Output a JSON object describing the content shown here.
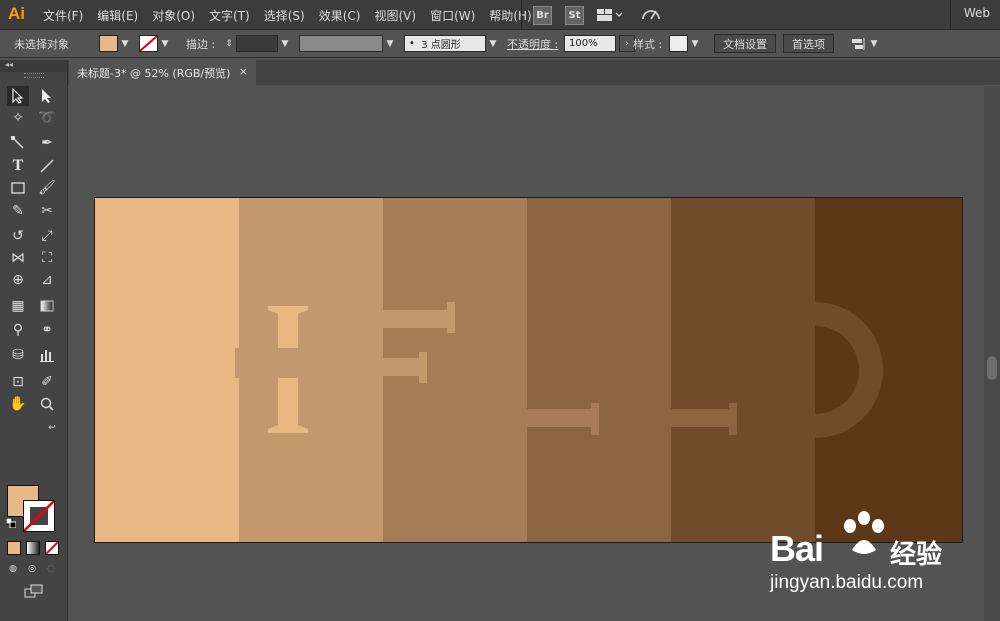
{
  "app": {
    "logo": "Ai",
    "menus": [
      "文件(F)",
      "编辑(E)",
      "对象(O)",
      "文字(T)",
      "选择(S)",
      "效果(C)",
      "视图(V)",
      "窗口(W)",
      "帮助(H)"
    ],
    "bridge_label": "Br",
    "stock_label": "St",
    "workspace": "Web"
  },
  "control_bar": {
    "selection_status": "未选择对象",
    "fill_color": "#e8b985",
    "stroke_label": "描边 :",
    "brush_label": "3 点圆形",
    "opacity_label": "不透明度 :",
    "opacity_value": "100%",
    "style_label": "样式 :",
    "doc_setup_button": "文档设置",
    "preferences_button": "首选项"
  },
  "document": {
    "tab_title": "未标题-3* @ 52% (RGB/预览)",
    "tab_close": "×"
  },
  "artwork": {
    "stripe_colors": [
      "#e8b985",
      "#c4986d",
      "#a67c56",
      "#8b6440",
      "#714c2c",
      "#5c3818"
    ],
    "text": "HELLO"
  },
  "watermark": {
    "brand": "Bai",
    "brand_suffix": "经验",
    "url": "jingyan.baidu.com"
  }
}
